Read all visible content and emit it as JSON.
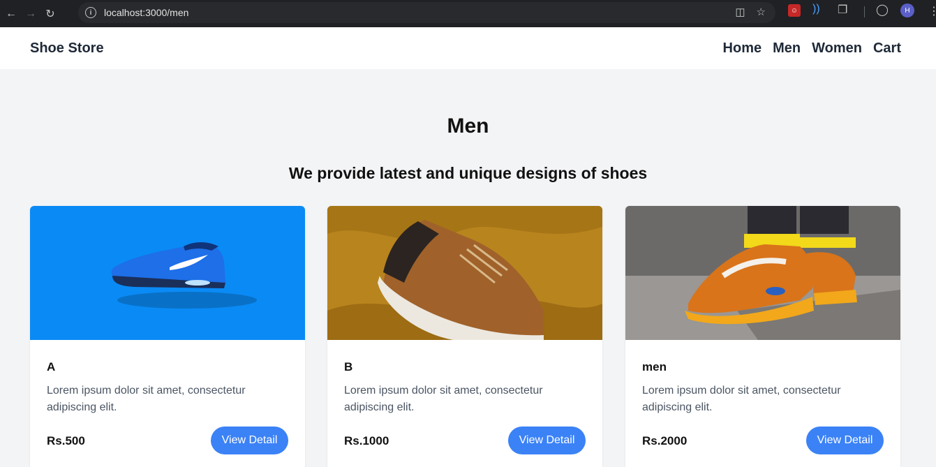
{
  "browser": {
    "url": "localhost:3000/men",
    "profile_initial": "H",
    "extension_badge": "☺"
  },
  "navbar": {
    "brand": "Shoe Store",
    "links": [
      "Home",
      "Men",
      "Women",
      "Cart"
    ]
  },
  "main": {
    "title": "Men",
    "subtitle": "We provide latest and unique designs of shoes"
  },
  "products": [
    {
      "name": "A",
      "description": "Lorem ipsum dolor sit amet, consectetur adipiscing elit.",
      "price": "Rs.500",
      "button": "View Detail",
      "image": "blue-sneaker-on-blue-background"
    },
    {
      "name": "B",
      "description": "Lorem ipsum dolor sit amet, consectetur adipiscing elit.",
      "price": "Rs.1000",
      "button": "View Detail",
      "image": "brown-sneaker-on-mustard-cloth"
    },
    {
      "name": "men",
      "description": "Lorem ipsum dolor sit amet, consectetur adipiscing elit.",
      "price": "Rs.2000",
      "button": "View Detail",
      "image": "orange-sneakers-on-feet"
    }
  ],
  "colors": {
    "accent": "#3b82f6",
    "page_bg": "#f3f4f6",
    "card1_bg": "#0a8af5",
    "card2_bg": "#b8841e",
    "card3_bg": "#8a8784"
  }
}
